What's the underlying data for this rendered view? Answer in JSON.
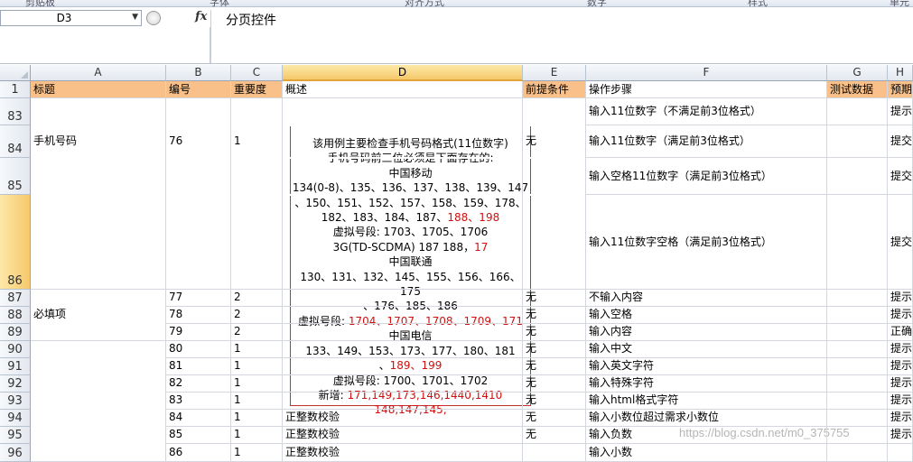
{
  "ribbon": {
    "items": [
      "剪贴板",
      "字体",
      "对齐方式",
      "数字",
      "样式",
      "单元"
    ]
  },
  "formula_bar": {
    "name_box": "D3",
    "fx_label": "fx",
    "content": "分页控件"
  },
  "columns": [
    {
      "letter": "A"
    },
    {
      "letter": "B"
    },
    {
      "letter": "C"
    },
    {
      "letter": "D"
    },
    {
      "letter": "E"
    },
    {
      "letter": "F"
    },
    {
      "letter": "G"
    },
    {
      "letter": "H"
    }
  ],
  "header_row": {
    "row_number": "1",
    "cells": [
      "标题",
      "编号",
      "重要度",
      "概述",
      "前提条件",
      "操作步骤",
      "测试数据",
      "预期"
    ]
  },
  "rows": [
    {
      "num": "83",
      "a": "",
      "b": "",
      "c": "",
      "d": "",
      "e": "",
      "f": "输入11位数字（不满足前3位格式）",
      "g": "",
      "h": "提示"
    },
    {
      "num": "84",
      "a": "手机号码",
      "b": "76",
      "c": "1",
      "d": "",
      "e": "无",
      "f": "输入11位数字（满足前3位格式）",
      "g": "",
      "h": "提交"
    },
    {
      "num": "85",
      "a": "",
      "b": "",
      "c": "",
      "d": "",
      "e": "",
      "f": "输入空格11位数字（满足前3位格式）",
      "g": "",
      "h": "提交"
    },
    {
      "num": "86",
      "a": "",
      "b": "",
      "c": "",
      "d": "",
      "e": "",
      "f": "输入11位数字空格（满足前3位格式）",
      "g": "",
      "h": "提交"
    },
    {
      "num": "87",
      "a": "",
      "b": "77",
      "c": "2",
      "d": "",
      "e": "无",
      "f": "不输入内容",
      "g": "",
      "h": "提示"
    },
    {
      "num": "88",
      "a": "必填项",
      "b": "78",
      "c": "2",
      "d": "",
      "e": "无",
      "f": "输入空格",
      "g": "",
      "h": "提示"
    },
    {
      "num": "89",
      "a": "",
      "b": "79",
      "c": "2",
      "d": "",
      "e": "无",
      "f": "输入内容",
      "g": "",
      "h": "正确"
    },
    {
      "num": "90",
      "a": "",
      "b": "80",
      "c": "1",
      "d": "",
      "e": "无",
      "f": "输入中文",
      "g": "",
      "h": "提示"
    },
    {
      "num": "91",
      "a": "",
      "b": "81",
      "c": "1",
      "d": "",
      "e": "无",
      "f": "输入英文字符",
      "g": "",
      "h": "提示"
    },
    {
      "num": "92",
      "a": "",
      "b": "82",
      "c": "1",
      "d": "",
      "e": "无",
      "f": "输入特殊字符",
      "g": "",
      "h": "提示"
    },
    {
      "num": "93",
      "a": "",
      "b": "83",
      "c": "1",
      "d": "",
      "e": "无",
      "f": "输入html格式字符",
      "g": "",
      "h": "提示"
    },
    {
      "num": "94",
      "a": "",
      "b": "84",
      "c": "1",
      "d": "正整数校验",
      "e": "无",
      "f": "输入小数位超过需求小数位",
      "g": "",
      "h": "提示"
    },
    {
      "num": "95",
      "a": "",
      "b": "85",
      "c": "1",
      "d": "正整数校验",
      "e": "无",
      "f": "输入负数",
      "g": "",
      "h": "提示"
    },
    {
      "num": "96",
      "a": "",
      "b": "86",
      "c": "1",
      "d": "正整数校验",
      "e": "",
      "f": "输入小数",
      "g": "",
      "h": ""
    }
  ],
  "comment_popup": {
    "lines": [
      {
        "text": "该用例主要检查手机号码格式(11位数字)",
        "red": ""
      },
      {
        "text": "手机号码前三位必须是下面存在的:",
        "red": ""
      },
      {
        "text": "中国移动",
        "red": ""
      },
      {
        "text": "134(0-8)、135、136、137、138、139、147",
        "red": ""
      },
      {
        "text": "、150、151、152、157、158、159、178、",
        "red": ""
      },
      {
        "text": "182、183、184、187、",
        "red": "188、198"
      },
      {
        "text": "虚拟号段: 1703、1705、1706",
        "red": ""
      },
      {
        "text": "3G(TD-SCDMA) 187 188，",
        "red": "17"
      },
      {
        "text": "中国联通",
        "red": ""
      },
      {
        "text": "130、131、132、145、155、156、166、175",
        "red": ""
      },
      {
        "text": "、176、185、186",
        "red": ""
      },
      {
        "text": "虚拟号段: ",
        "red": "1704、1707、1708、1709、171"
      },
      {
        "text": "中国电信",
        "red": ""
      },
      {
        "text": "133、149、153、173、177、180、181",
        "red": ""
      },
      {
        "text": "、",
        "red": "189、199"
      },
      {
        "text": "虚拟号段: 1700、1701、1702",
        "red": ""
      },
      {
        "text": "新增: ",
        "red": "171,149,173,146,1440,1410"
      },
      {
        "text": "",
        "red": "148,147,145,"
      }
    ]
  },
  "watermark": "https://blog.csdn.net/m0_375755"
}
